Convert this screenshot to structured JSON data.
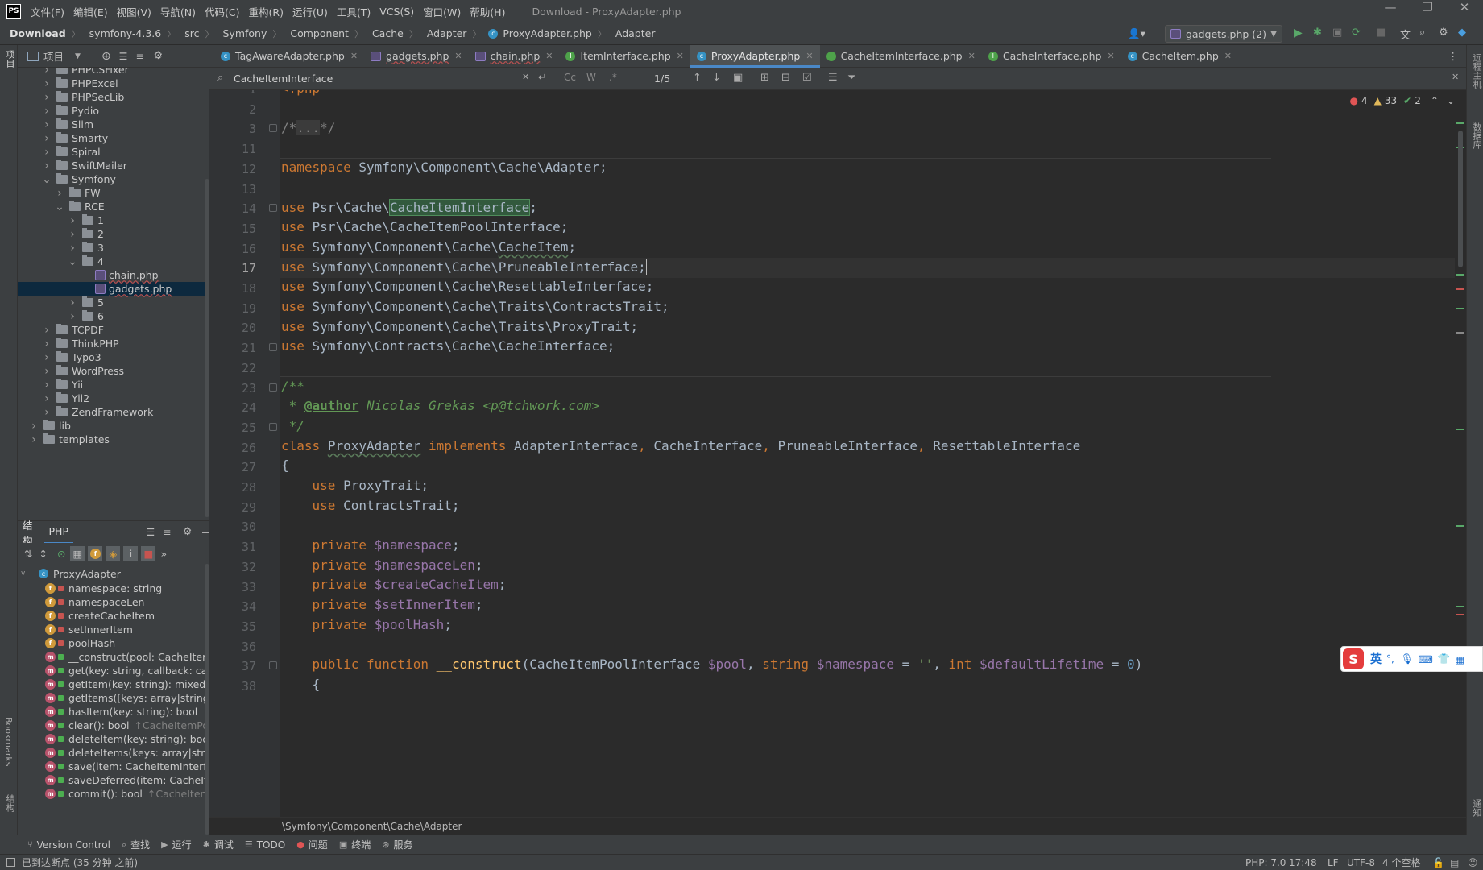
{
  "menubar": {
    "logo": "PS",
    "items": [
      "文件(F)",
      "编辑(E)",
      "视图(V)",
      "导航(N)",
      "代码(C)",
      "重构(R)",
      "运行(U)",
      "工具(T)",
      "VCS(S)",
      "窗口(W)",
      "帮助(H)"
    ],
    "window_title": "Download - ProxyAdapter.php"
  },
  "navbar": {
    "crumbs": [
      "Download",
      "symfony-4.3.6",
      "src",
      "Symfony",
      "Component",
      "Cache",
      "Adapter",
      "ProxyAdapter.php",
      "Adapter"
    ],
    "run_config": "gadgets.php (2)"
  },
  "left_strip": {
    "project": "项目",
    "bookmarks": "Bookmarks",
    "structure": "结构"
  },
  "right_strip": {
    "remote": "远程主机",
    "database": "数据库",
    "notifications": "通知"
  },
  "project_panel": {
    "title": "项目",
    "tree": [
      {
        "label": "PHPCSFixer",
        "depth": 3,
        "arrow": ">",
        "kind": "folder"
      },
      {
        "label": "PHPExcel",
        "depth": 3,
        "arrow": ">",
        "kind": "folder"
      },
      {
        "label": "PHPSecLib",
        "depth": 3,
        "arrow": ">",
        "kind": "folder"
      },
      {
        "label": "Pydio",
        "depth": 3,
        "arrow": ">",
        "kind": "folder"
      },
      {
        "label": "Slim",
        "depth": 3,
        "arrow": ">",
        "kind": "folder"
      },
      {
        "label": "Smarty",
        "depth": 3,
        "arrow": ">",
        "kind": "folder"
      },
      {
        "label": "Spiral",
        "depth": 3,
        "arrow": ">",
        "kind": "folder"
      },
      {
        "label": "SwiftMailer",
        "depth": 3,
        "arrow": ">",
        "kind": "folder"
      },
      {
        "label": "Symfony",
        "depth": 3,
        "arrow": "v",
        "kind": "folder"
      },
      {
        "label": "FW",
        "depth": 4,
        "arrow": ">",
        "kind": "folder"
      },
      {
        "label": "RCE",
        "depth": 4,
        "arrow": "v",
        "kind": "folder"
      },
      {
        "label": "1",
        "depth": 5,
        "arrow": ">",
        "kind": "folder"
      },
      {
        "label": "2",
        "depth": 5,
        "arrow": ">",
        "kind": "folder"
      },
      {
        "label": "3",
        "depth": 5,
        "arrow": ">",
        "kind": "folder"
      },
      {
        "label": "4",
        "depth": 5,
        "arrow": "v",
        "kind": "folder"
      },
      {
        "label": "chain.php",
        "depth": 6,
        "arrow": "",
        "kind": "php"
      },
      {
        "label": "gadgets.php",
        "depth": 6,
        "arrow": "",
        "kind": "php",
        "selected": true
      },
      {
        "label": "5",
        "depth": 5,
        "arrow": ">",
        "kind": "folder"
      },
      {
        "label": "6",
        "depth": 5,
        "arrow": ">",
        "kind": "folder"
      },
      {
        "label": "TCPDF",
        "depth": 3,
        "arrow": ">",
        "kind": "folder"
      },
      {
        "label": "ThinkPHP",
        "depth": 3,
        "arrow": ">",
        "kind": "folder"
      },
      {
        "label": "Typo3",
        "depth": 3,
        "arrow": ">",
        "kind": "folder"
      },
      {
        "label": "WordPress",
        "depth": 3,
        "arrow": ">",
        "kind": "folder"
      },
      {
        "label": "Yii",
        "depth": 3,
        "arrow": ">",
        "kind": "folder"
      },
      {
        "label": "Yii2",
        "depth": 3,
        "arrow": ">",
        "kind": "folder"
      },
      {
        "label": "ZendFramework",
        "depth": 3,
        "arrow": ">",
        "kind": "folder"
      },
      {
        "label": "lib",
        "depth": 2,
        "arrow": ">",
        "kind": "folder"
      },
      {
        "label": "templates",
        "depth": 2,
        "arrow": ">",
        "kind": "folder"
      }
    ]
  },
  "structure_panel": {
    "tabs": [
      "结构",
      "PHP"
    ],
    "root": "ProxyAdapter",
    "items": [
      {
        "badge": "f",
        "lock": "red",
        "label": "namespace: string",
        "hint": ""
      },
      {
        "badge": "f",
        "lock": "red",
        "label": "namespaceLen",
        "hint": ""
      },
      {
        "badge": "f",
        "lock": "red",
        "label": "createCacheItem",
        "hint": ""
      },
      {
        "badge": "f",
        "lock": "red",
        "label": "setInnerItem",
        "hint": ""
      },
      {
        "badge": "f",
        "lock": "red",
        "label": "poolHash",
        "hint": ""
      },
      {
        "badge": "m",
        "lock": "green",
        "label": "__construct(pool: CacheItem",
        "hint": ""
      },
      {
        "badge": "m",
        "lock": "green",
        "label": "get(key: string, callback: cal",
        "hint": ""
      },
      {
        "badge": "m",
        "lock": "green",
        "label": "getItem(key: string): mixed|",
        "hint": ""
      },
      {
        "badge": "m",
        "lock": "green",
        "label": "getItems([keys: array|string",
        "hint": ""
      },
      {
        "badge": "m",
        "lock": "green",
        "label": "hasItem(key: string): bool",
        "hint": "↑CacheItemPo"
      },
      {
        "badge": "m",
        "lock": "green",
        "label": "clear(): bool",
        "hint": "↑CacheItemPo"
      },
      {
        "badge": "m",
        "lock": "green",
        "label": "deleteItem(key: string): boo",
        "hint": ""
      },
      {
        "badge": "m",
        "lock": "green",
        "label": "deleteItems(keys: array|strin",
        "hint": ""
      },
      {
        "badge": "m",
        "lock": "green",
        "label": "save(item: CacheItemInterfa",
        "hint": ""
      },
      {
        "badge": "m",
        "lock": "green",
        "label": "saveDeferred(item: CacheIte",
        "hint": ""
      },
      {
        "badge": "m",
        "lock": "green",
        "label": "commit(): bool",
        "hint": "↑CacheItem"
      }
    ]
  },
  "tabs": [
    {
      "label": "TagAwareAdapter.php",
      "icon": "class"
    },
    {
      "label": "gadgets.php",
      "icon": "php"
    },
    {
      "label": "chain.php",
      "icon": "php"
    },
    {
      "label": "ItemInterface.php",
      "icon": "interface"
    },
    {
      "label": "ProxyAdapter.php",
      "icon": "class",
      "active": true
    },
    {
      "label": "CacheItemInterface.php",
      "icon": "interface"
    },
    {
      "label": "CacheInterface.php",
      "icon": "interface"
    },
    {
      "label": "CacheItem.php",
      "icon": "class"
    }
  ],
  "search": {
    "query": "CacheItemInterface",
    "count": "1/5",
    "opt_case": "Cc",
    "opt_word": "W",
    "opt_regex": ".*"
  },
  "inspections": {
    "errors": "4",
    "warnings": "33",
    "ok": "2"
  },
  "line_numbers": [
    "1",
    "2",
    "3",
    "11",
    "12",
    "13",
    "14",
    "15",
    "16",
    "17",
    "18",
    "19",
    "20",
    "21",
    "22",
    "23",
    "24",
    "25",
    "26",
    "27",
    "28",
    "29",
    "30",
    "31",
    "32",
    "33",
    "34",
    "35",
    "36",
    "37",
    "38"
  ],
  "code_breadcrumb": "\\Symfony\\Component\\Cache\\Adapter",
  "toolwindows": [
    "Version Control",
    "查找",
    "运行",
    "调试",
    "TODO",
    "问题",
    "终端",
    "服务"
  ],
  "status": {
    "message": "已到达断点 (35 分钟 之前)",
    "php": "PHP: 7.0",
    "position": "17:48",
    "line_sep": "LF",
    "encoding": "UTF-8",
    "indent": "4 个空格"
  },
  "ime": {
    "lang": "英",
    "punct": "°,"
  }
}
